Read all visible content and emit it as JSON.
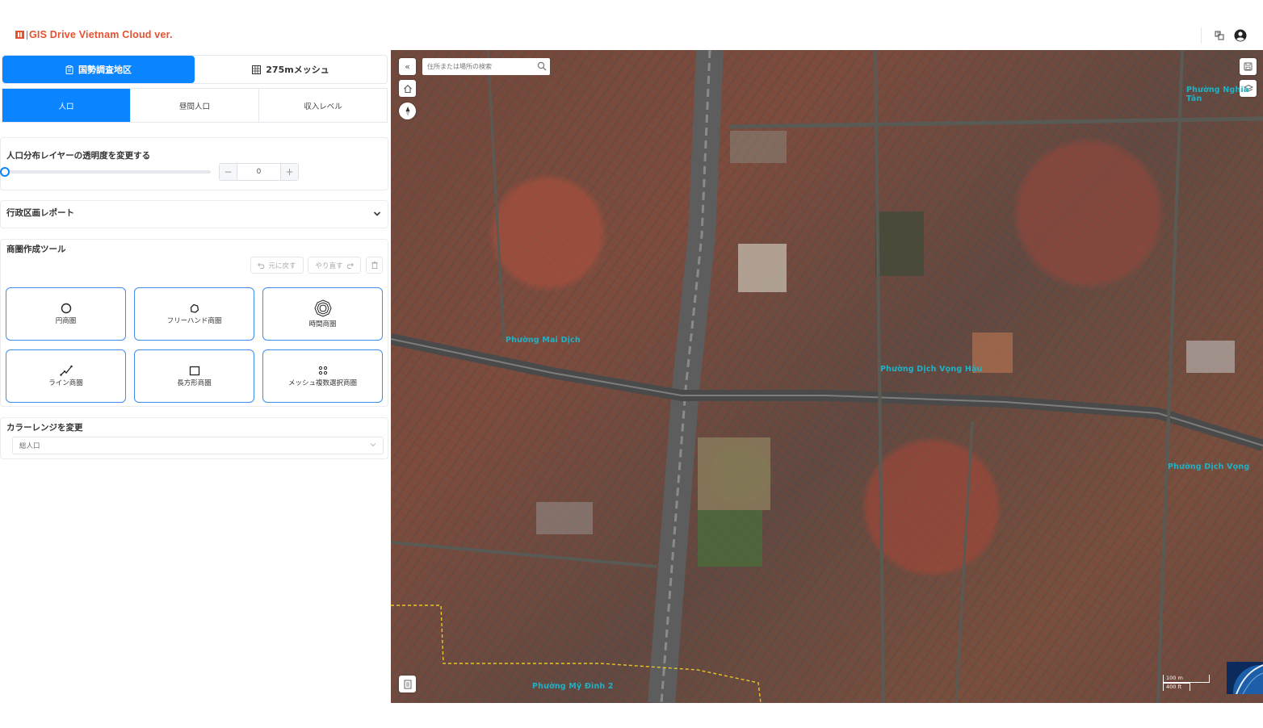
{
  "header": {
    "app_title": "GIS Drive Vietnam Cloud ver.",
    "icons": [
      "translate-icon",
      "user-account-icon"
    ]
  },
  "panel": {
    "main_tabs": [
      {
        "label": "国勢調査地区",
        "icon": "clipboard-icon",
        "active": true
      },
      {
        "label": "275mメッシュ",
        "icon": "grid-icon",
        "active": false
      }
    ],
    "sub_tabs": [
      {
        "label": "人口",
        "active": true
      },
      {
        "label": "昼間人口",
        "active": false
      },
      {
        "label": "収入レベル",
        "active": false
      }
    ],
    "opacity": {
      "title": "人口分布レイヤーの透明度を変更する",
      "value": "0",
      "slider_fraction": 0
    },
    "admin_report": {
      "title": "行政区画レポート"
    },
    "trade_area": {
      "title": "商圏作成ツール",
      "undo_label": "元に戻す",
      "redo_label": "やり直す",
      "tools": [
        {
          "label": "円商圏",
          "icon": "circle-icon"
        },
        {
          "label": "フリーハンド商圏",
          "icon": "freehand-icon"
        },
        {
          "label": "時間商圏",
          "icon": "isochrone-icon"
        },
        {
          "label": "ライン商圏",
          "icon": "line-icon"
        },
        {
          "label": "長方形商圏",
          "icon": "rectangle-icon"
        },
        {
          "label": "メッシュ複数選択商圏",
          "icon": "mesh-dots-icon"
        }
      ]
    },
    "color_range": {
      "title": "カラーレンジを変更",
      "selected": "総人口"
    }
  },
  "map": {
    "search_placeholder": "住所または場所の検索",
    "collapse_label": "«",
    "wards": [
      {
        "name": "Phường Mai Dịch"
      },
      {
        "name": "Phường Dịch Vọng Hậu"
      },
      {
        "name": "Phường Dịch Vọng"
      },
      {
        "name": "Phường Mỹ Đình 2"
      },
      {
        "name": "Phường Nghĩa Tân"
      }
    ],
    "scale": {
      "metric": "100 m",
      "imperial": "400 ft"
    }
  },
  "colors": {
    "accent": "#0a84ff",
    "logo": "#e8512f",
    "ward_label": "#1fb2c6"
  }
}
